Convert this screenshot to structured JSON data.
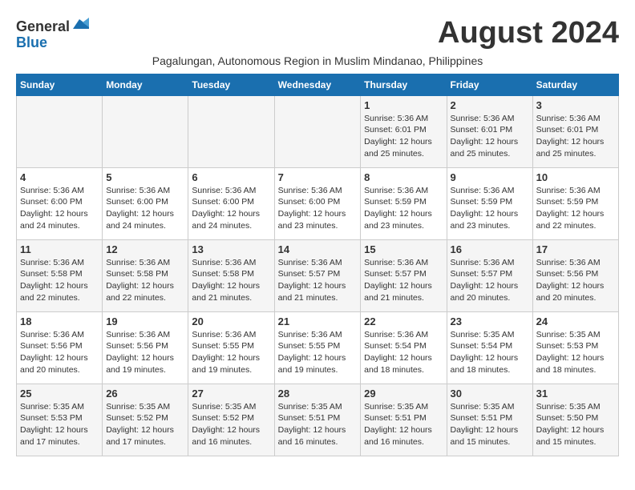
{
  "header": {
    "logo_general": "General",
    "logo_blue": "Blue",
    "month_title": "August 2024",
    "subtitle": "Pagalungan, Autonomous Region in Muslim Mindanao, Philippines"
  },
  "days_of_week": [
    "Sunday",
    "Monday",
    "Tuesday",
    "Wednesday",
    "Thursday",
    "Friday",
    "Saturday"
  ],
  "weeks": [
    {
      "days": [
        {
          "number": "",
          "info": ""
        },
        {
          "number": "",
          "info": ""
        },
        {
          "number": "",
          "info": ""
        },
        {
          "number": "",
          "info": ""
        },
        {
          "number": "1",
          "info": "Sunrise: 5:36 AM\nSunset: 6:01 PM\nDaylight: 12 hours and 25 minutes."
        },
        {
          "number": "2",
          "info": "Sunrise: 5:36 AM\nSunset: 6:01 PM\nDaylight: 12 hours and 25 minutes."
        },
        {
          "number": "3",
          "info": "Sunrise: 5:36 AM\nSunset: 6:01 PM\nDaylight: 12 hours and 25 minutes."
        }
      ]
    },
    {
      "days": [
        {
          "number": "4",
          "info": "Sunrise: 5:36 AM\nSunset: 6:00 PM\nDaylight: 12 hours and 24 minutes."
        },
        {
          "number": "5",
          "info": "Sunrise: 5:36 AM\nSunset: 6:00 PM\nDaylight: 12 hours and 24 minutes."
        },
        {
          "number": "6",
          "info": "Sunrise: 5:36 AM\nSunset: 6:00 PM\nDaylight: 12 hours and 24 minutes."
        },
        {
          "number": "7",
          "info": "Sunrise: 5:36 AM\nSunset: 6:00 PM\nDaylight: 12 hours and 23 minutes."
        },
        {
          "number": "8",
          "info": "Sunrise: 5:36 AM\nSunset: 5:59 PM\nDaylight: 12 hours and 23 minutes."
        },
        {
          "number": "9",
          "info": "Sunrise: 5:36 AM\nSunset: 5:59 PM\nDaylight: 12 hours and 23 minutes."
        },
        {
          "number": "10",
          "info": "Sunrise: 5:36 AM\nSunset: 5:59 PM\nDaylight: 12 hours and 22 minutes."
        }
      ]
    },
    {
      "days": [
        {
          "number": "11",
          "info": "Sunrise: 5:36 AM\nSunset: 5:58 PM\nDaylight: 12 hours and 22 minutes."
        },
        {
          "number": "12",
          "info": "Sunrise: 5:36 AM\nSunset: 5:58 PM\nDaylight: 12 hours and 22 minutes."
        },
        {
          "number": "13",
          "info": "Sunrise: 5:36 AM\nSunset: 5:58 PM\nDaylight: 12 hours and 21 minutes."
        },
        {
          "number": "14",
          "info": "Sunrise: 5:36 AM\nSunset: 5:57 PM\nDaylight: 12 hours and 21 minutes."
        },
        {
          "number": "15",
          "info": "Sunrise: 5:36 AM\nSunset: 5:57 PM\nDaylight: 12 hours and 21 minutes."
        },
        {
          "number": "16",
          "info": "Sunrise: 5:36 AM\nSunset: 5:57 PM\nDaylight: 12 hours and 20 minutes."
        },
        {
          "number": "17",
          "info": "Sunrise: 5:36 AM\nSunset: 5:56 PM\nDaylight: 12 hours and 20 minutes."
        }
      ]
    },
    {
      "days": [
        {
          "number": "18",
          "info": "Sunrise: 5:36 AM\nSunset: 5:56 PM\nDaylight: 12 hours and 20 minutes."
        },
        {
          "number": "19",
          "info": "Sunrise: 5:36 AM\nSunset: 5:56 PM\nDaylight: 12 hours and 19 minutes."
        },
        {
          "number": "20",
          "info": "Sunrise: 5:36 AM\nSunset: 5:55 PM\nDaylight: 12 hours and 19 minutes."
        },
        {
          "number": "21",
          "info": "Sunrise: 5:36 AM\nSunset: 5:55 PM\nDaylight: 12 hours and 19 minutes."
        },
        {
          "number": "22",
          "info": "Sunrise: 5:36 AM\nSunset: 5:54 PM\nDaylight: 12 hours and 18 minutes."
        },
        {
          "number": "23",
          "info": "Sunrise: 5:35 AM\nSunset: 5:54 PM\nDaylight: 12 hours and 18 minutes."
        },
        {
          "number": "24",
          "info": "Sunrise: 5:35 AM\nSunset: 5:53 PM\nDaylight: 12 hours and 18 minutes."
        }
      ]
    },
    {
      "days": [
        {
          "number": "25",
          "info": "Sunrise: 5:35 AM\nSunset: 5:53 PM\nDaylight: 12 hours and 17 minutes."
        },
        {
          "number": "26",
          "info": "Sunrise: 5:35 AM\nSunset: 5:52 PM\nDaylight: 12 hours and 17 minutes."
        },
        {
          "number": "27",
          "info": "Sunrise: 5:35 AM\nSunset: 5:52 PM\nDaylight: 12 hours and 16 minutes."
        },
        {
          "number": "28",
          "info": "Sunrise: 5:35 AM\nSunset: 5:51 PM\nDaylight: 12 hours and 16 minutes."
        },
        {
          "number": "29",
          "info": "Sunrise: 5:35 AM\nSunset: 5:51 PM\nDaylight: 12 hours and 16 minutes."
        },
        {
          "number": "30",
          "info": "Sunrise: 5:35 AM\nSunset: 5:51 PM\nDaylight: 12 hours and 15 minutes."
        },
        {
          "number": "31",
          "info": "Sunrise: 5:35 AM\nSunset: 5:50 PM\nDaylight: 12 hours and 15 minutes."
        }
      ]
    }
  ]
}
